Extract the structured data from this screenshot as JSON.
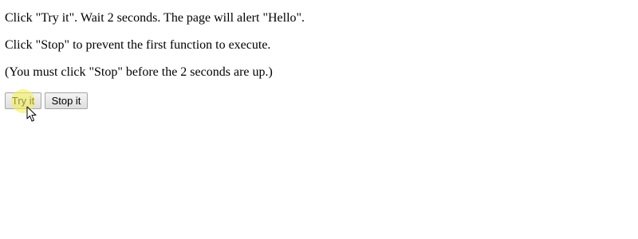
{
  "instructions": {
    "line1": "Click \"Try it\". Wait 2 seconds. The page will alert \"Hello\".",
    "line2": "Click \"Stop\" to prevent the first function to execute.",
    "line3": "(You must click \"Stop\" before the 2 seconds are up.)"
  },
  "buttons": {
    "try_label": "Try it",
    "stop_label": "Stop it"
  },
  "cursor": {
    "icon": "arrow-cursor-icon",
    "highlight_color": "#f5ee5a"
  }
}
